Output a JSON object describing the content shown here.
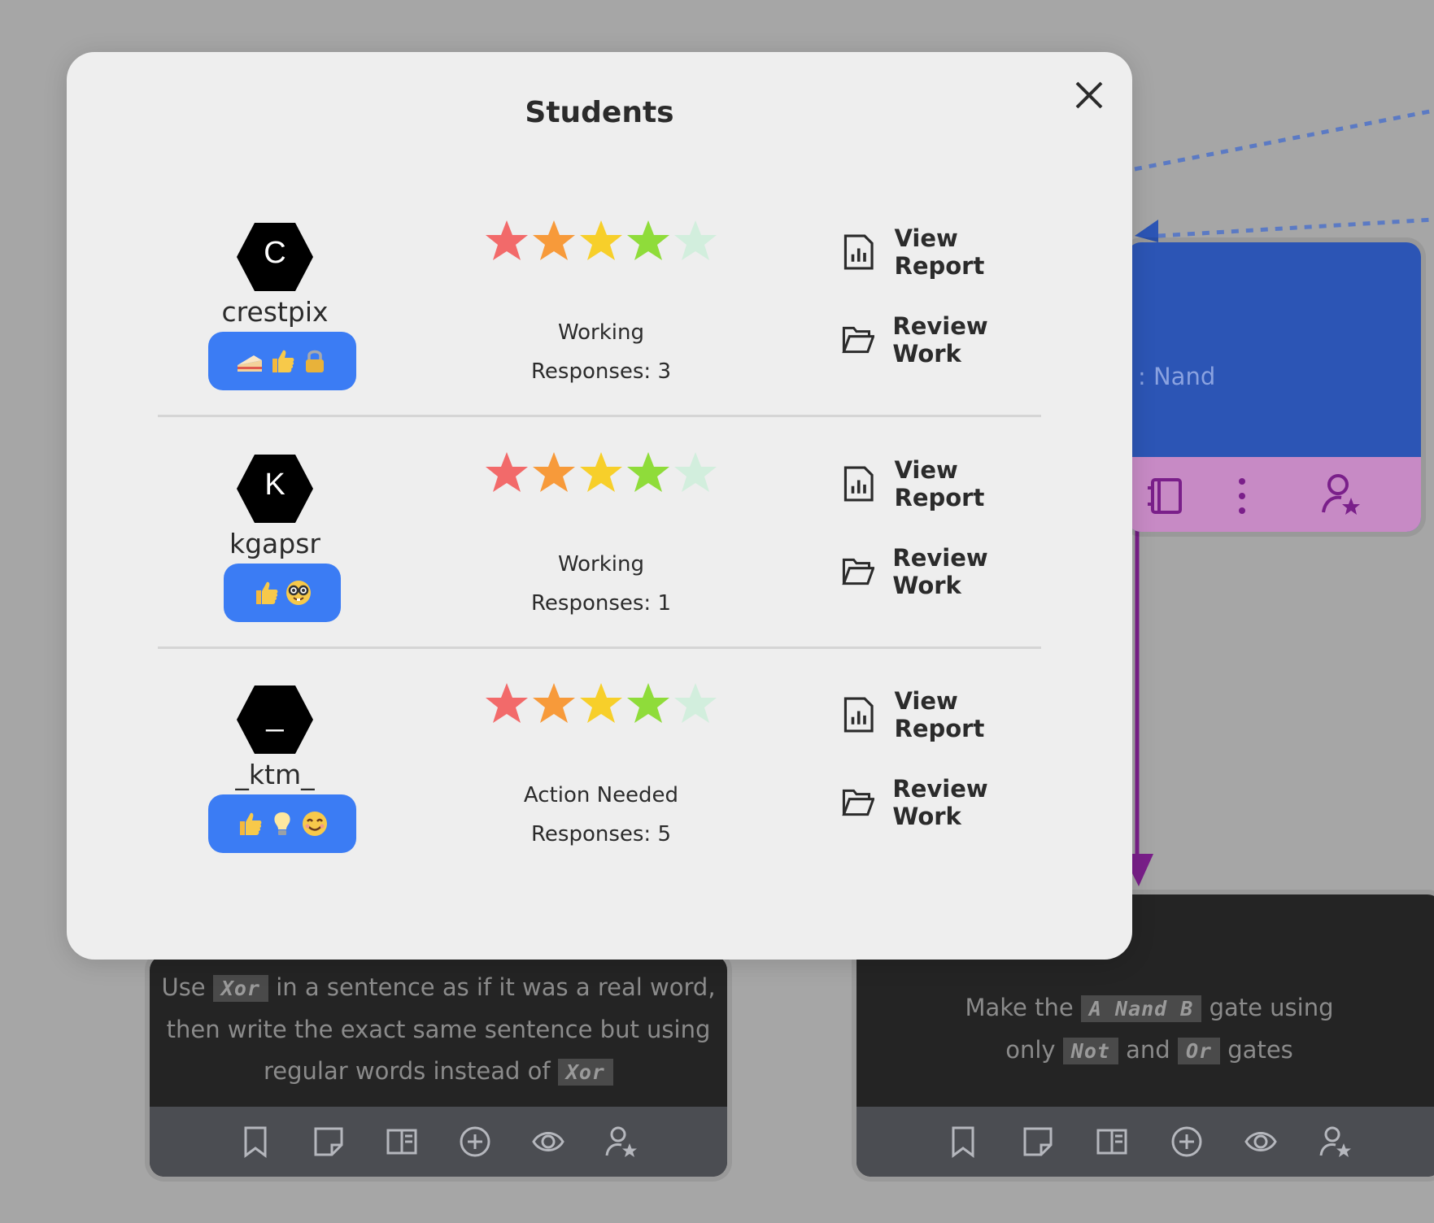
{
  "modal": {
    "title": "Students"
  },
  "students": [
    {
      "initial": "C",
      "name": "crestpix",
      "badges": [
        "cake",
        "thumbs-up",
        "lock"
      ],
      "rating": 4,
      "status": "Working",
      "responses": "Responses: 3"
    },
    {
      "initial": "K",
      "name": "kgapsr",
      "badges": [
        "thumbs-up",
        "nerd-face"
      ],
      "rating": 4,
      "status": "Working",
      "responses": "Responses: 1"
    },
    {
      "initial": "_",
      "name": "_ktm_",
      "badges": [
        "thumbs-up",
        "lightbulb",
        "smiling-face"
      ],
      "rating": 4,
      "status": "Action Needed",
      "responses": "Responses: 5"
    }
  ],
  "actions": {
    "view_report": "View Report",
    "review_work": "Review Work"
  },
  "background": {
    "blue_card_partial": ": Nand",
    "card_left": {
      "t1": "Use",
      "code1": "Xor",
      "t2": "in a sentence as if it was a real word,",
      "t3": "then write the exact same sentence but using",
      "t4": "regular words instead of",
      "code2": "Xor"
    },
    "card_right": {
      "t1": "Make the",
      "code1": "A Nand B",
      "t2": "gate using",
      "t3": "only",
      "code2": "Not",
      "t4": "and",
      "code3": "Or",
      "t5": "gates"
    }
  },
  "colors": {
    "star_colors": [
      "#f26a6a",
      "#f79a3a",
      "#f7cf2a",
      "#8fdc3a",
      "#d2eedd"
    ],
    "badge": "#3b7cf4",
    "modal_bg": "#eeeeee"
  }
}
